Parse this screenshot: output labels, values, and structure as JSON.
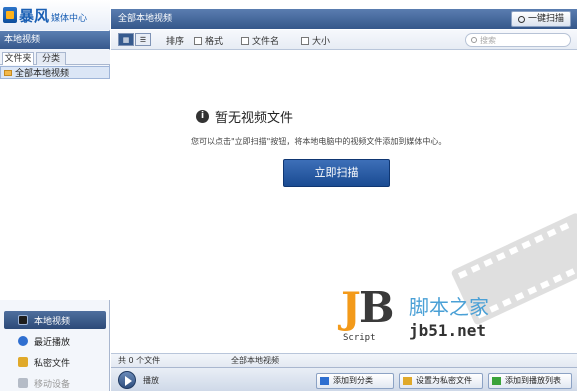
{
  "app": {
    "logo_text": "暴风",
    "logo_subtext": "媒体中心"
  },
  "sidebar": {
    "header": "本地视频",
    "tabs": [
      {
        "label": "文件夹",
        "active": true
      },
      {
        "label": "分类",
        "active": false
      }
    ],
    "items": [
      {
        "label": "全部本地视频",
        "selected": true
      }
    ],
    "nav": [
      {
        "label": "本地视频",
        "icon": "film-icon",
        "active": true
      },
      {
        "label": "最近播放",
        "icon": "clock-icon",
        "active": false
      },
      {
        "label": "私密文件",
        "icon": "lock-icon",
        "active": false
      },
      {
        "label": "移动设备",
        "icon": "device-icon",
        "active": false,
        "disabled": true
      }
    ]
  },
  "main": {
    "title": "全部本地视频",
    "scan_button": "一键扫描",
    "view_buttons": [
      "图标",
      "列表"
    ],
    "sort_items": [
      {
        "label": "排序",
        "icon": "sort-icon"
      },
      {
        "label": "格式",
        "icon": "format-icon"
      },
      {
        "label": "文件名",
        "icon": "filename-icon"
      },
      {
        "label": "大小",
        "icon": "size-icon"
      }
    ],
    "search_placeholder": "搜索",
    "empty_title": "暂无视频文件",
    "empty_desc": "您可以点击\"立即扫描\"按钮，将本地电脑中的视频文件添加到媒体中心。",
    "scan_now": "立即扫描",
    "status_count": "共 0 个文件",
    "status_mode": "全部本地视频",
    "play_label": "播放",
    "bottom_buttons": [
      {
        "label": "添加到分类",
        "icon": "add-category-icon"
      },
      {
        "label": "设置为私密文件",
        "icon": "lock-icon"
      },
      {
        "label": "添加到播放列表",
        "icon": "add-playlist-icon"
      }
    ]
  },
  "watermark": {
    "letter_j": "J",
    "letter_b": "B",
    "script": "Script",
    "cn": "脚本之家",
    "url": "jb51.net"
  },
  "colors": {
    "header_blue": "#35578a",
    "accent_orange": "#f39a1a",
    "button_blue": "#1a4b92"
  }
}
